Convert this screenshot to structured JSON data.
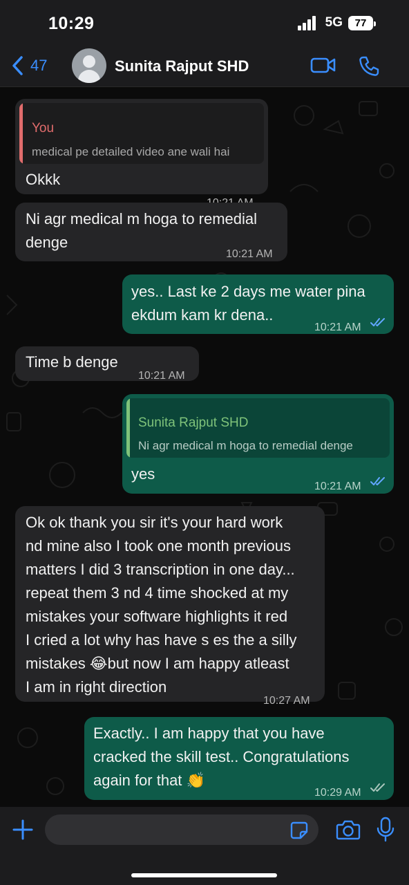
{
  "status": {
    "time": "10:29",
    "network": "5G",
    "battery": "77"
  },
  "header": {
    "back_count": "47",
    "contact_name": "Sunita Rajput SHD"
  },
  "messages": [
    {
      "quote_author": "You",
      "quote_text": "medical pe detailed video ane wali hai",
      "lines": [
        "Okkk"
      ],
      "time": "10:21 AM"
    },
    {
      "lines": [
        "Ni agr medical m hoga to remedial",
        "denge"
      ],
      "time": "10:21 AM"
    },
    {
      "lines": [
        "yes.. Last ke 2 days me water pina",
        "ekdum kam kr dena.."
      ],
      "time": "10:21 AM"
    },
    {
      "lines": [
        "Time b denge"
      ],
      "time": "10:21 AM"
    },
    {
      "quote_author": "Sunita Rajput SHD",
      "quote_text": "Ni agr medical m hoga to remedial denge",
      "lines": [
        "yes"
      ],
      "time": "10:21 AM"
    },
    {
      "lines": [
        "Ok ok thank you sir it's your hard work",
        "nd mine also I took one month previous",
        "matters I did 3 transcription in one day...",
        "repeat them 3 nd 4 time shocked at my",
        "mistakes your software highlights it red",
        "I cried a lot why has have s es the a silly",
        "mistakes 😂but now I am happy atleast",
        "I am in right direction"
      ],
      "time": "10:27 AM"
    },
    {
      "lines": [
        "Exactly.. I am happy that you have",
        "cracked the skill test.. Congratulations",
        "again for that 👏"
      ],
      "time": "10:29 AM"
    }
  ],
  "colors": {
    "incoming": "#252527",
    "outgoing": "#0e5b49",
    "accent": "#3a8eff",
    "you_quote": "#e06c6c",
    "contact_quote": "#7fc37a"
  },
  "icons": {
    "back": "chevron-left-icon",
    "video": "video-call-icon",
    "call": "phone-icon",
    "add": "plus-icon",
    "sticker": "sticker-icon",
    "camera": "camera-icon",
    "mic": "microphone-icon"
  }
}
